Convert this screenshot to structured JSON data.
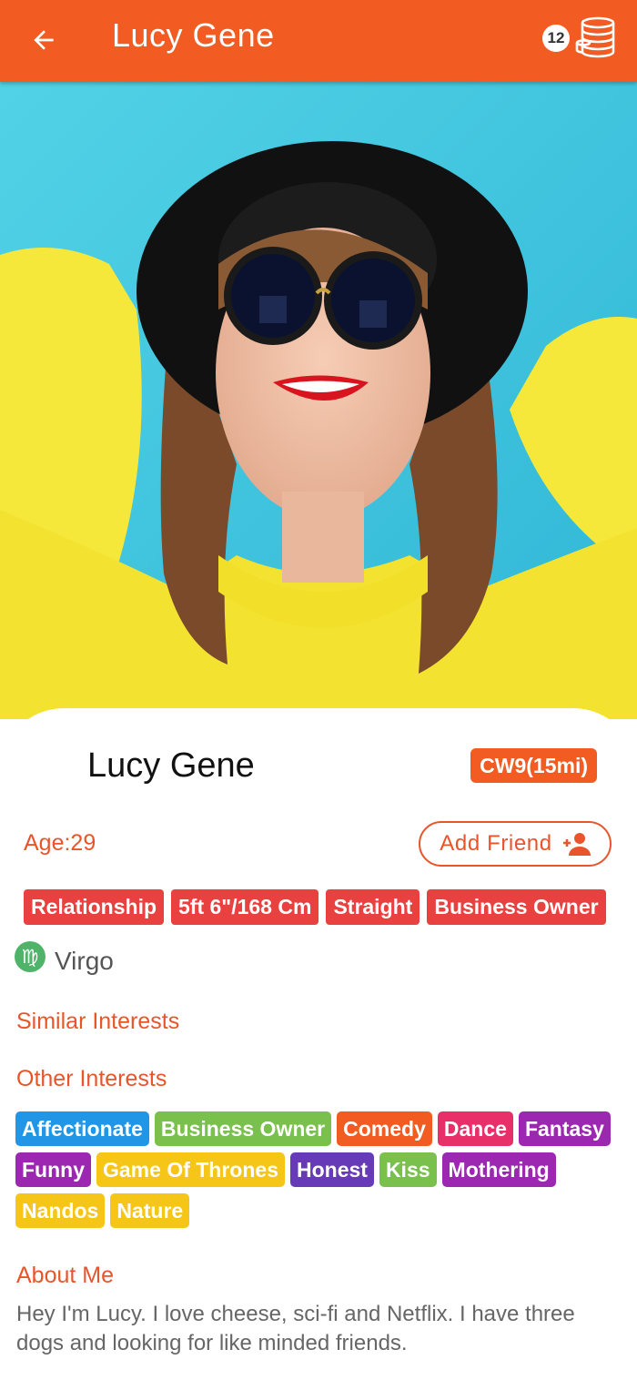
{
  "header": {
    "title": "Lucy Gene",
    "back_icon": "arrow-left-icon",
    "coins_count": "12",
    "coins_icon": "coin-stack-icon",
    "color": "#f25c22"
  },
  "profile": {
    "photo_icon": "profile-photo",
    "name": "Lucy Gene",
    "distance": "CW9(15mi)",
    "age": "Age:29",
    "add_friend_label": "Add Friend",
    "add_friend_icon": "add-person-icon",
    "tags": [
      "Relationship",
      "5ft 6\"/168 Cm",
      "Straight",
      "Business Owner"
    ],
    "zodiac": {
      "label": "Virgo",
      "icon": "virgo-icon",
      "glyph": "♍",
      "color": "#4fb36a"
    }
  },
  "sections": {
    "similar_interests": "Similar Interests",
    "other_interests": "Other Interests",
    "about_me": "About Me"
  },
  "interests": [
    {
      "label": "Affectionate",
      "color": "#2196e6"
    },
    {
      "label": "Business Owner",
      "color": "#79c04c"
    },
    {
      "label": "Comedy",
      "color": "#f25c22"
    },
    {
      "label": "Dance",
      "color": "#e82f6a"
    },
    {
      "label": "Fantasy",
      "color": "#9c27b0"
    },
    {
      "label": "Funny",
      "color": "#9c27b0"
    },
    {
      "label": "Game Of Thrones",
      "color": "#f5c518"
    },
    {
      "label": "Honest",
      "color": "#673ab7"
    },
    {
      "label": "Kiss",
      "color": "#79c04c"
    },
    {
      "label": "Mothering",
      "color": "#9c27b0"
    },
    {
      "label": "Nandos",
      "color": "#f5c518"
    },
    {
      "label": "Nature",
      "color": "#f5c518"
    }
  ],
  "about_text": "Hey I'm Lucy. I love cheese, sci-fi and Netflix. I have three dogs and looking for like minded friends."
}
